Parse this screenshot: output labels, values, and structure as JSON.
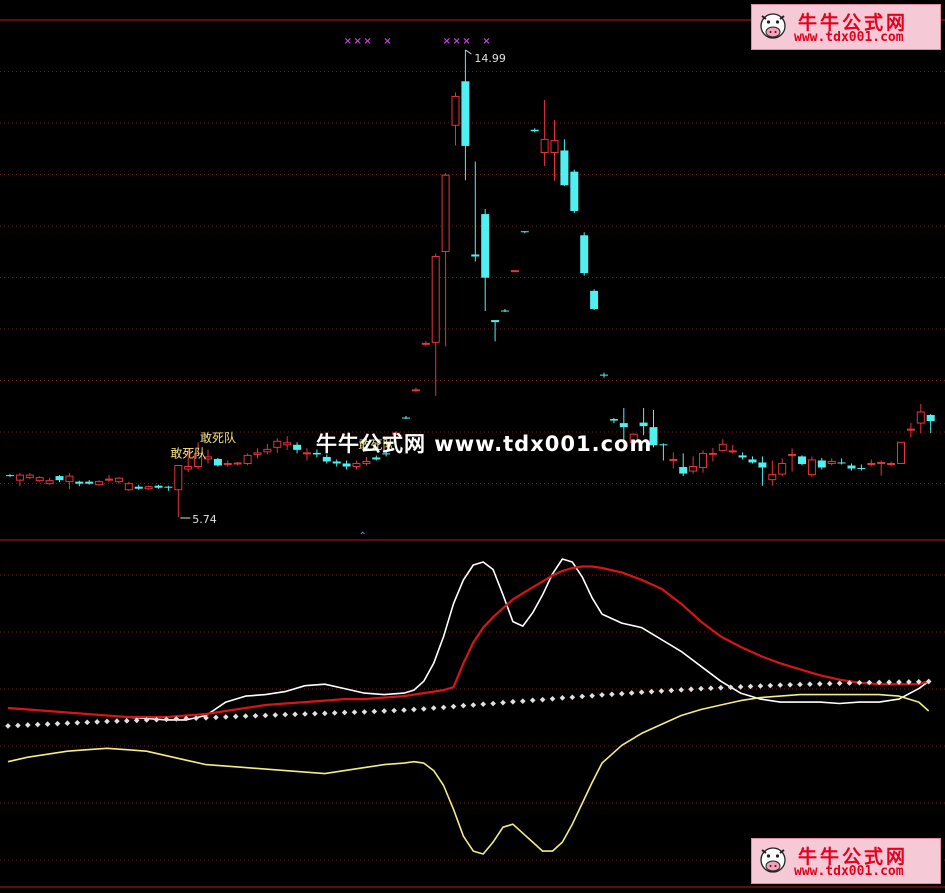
{
  "watermark": {
    "center_text": "牛牛公式网 www.tdx001.com",
    "logo_title": "牛牛公式网",
    "logo_url": "www.tdx001.com"
  },
  "colors": {
    "background": "#000000",
    "up_candle": "#e8333a",
    "down_candle": "#50f0f0",
    "grid": "#7a1616",
    "divider": "#c21818",
    "line_white": "#ffffff",
    "line_red": "#d81414",
    "line_yellow": "#f2ec82",
    "dots": "#e0e0e0",
    "markers": "#c040e0",
    "label": "#f0e080"
  },
  "chart_data": [
    {
      "type": "candlestick",
      "ylim": [
        5.4,
        15.6
      ],
      "annotations": {
        "high_label": "14.99",
        "low_label": "5.74",
        "signal_label": "敢死队"
      },
      "signal_label_candles": [
        17,
        20,
        36
      ],
      "top_marker_glyph": "×",
      "top_marker_candles": [
        34,
        35,
        36,
        38,
        44,
        45,
        46,
        48
      ],
      "bottom_marker_glyph": "⌃",
      "bottom_marker_candle": 35,
      "candles": [
        [
          6.57,
          6.55,
          6.59,
          6.53
        ],
        [
          6.47,
          6.57,
          6.61,
          6.35
        ],
        [
          6.52,
          6.57,
          6.61,
          6.49
        ],
        [
          6.46,
          6.52,
          6.55,
          6.44
        ],
        [
          6.4,
          6.46,
          6.52,
          6.38
        ],
        [
          6.55,
          6.47,
          6.57,
          6.43
        ],
        [
          6.44,
          6.55,
          6.61,
          6.29
        ],
        [
          6.44,
          6.4,
          6.46,
          6.35
        ],
        [
          6.44,
          6.4,
          6.47,
          6.38
        ],
        [
          6.38,
          6.44,
          6.47,
          6.36
        ],
        [
          6.48,
          6.49,
          6.57,
          6.43
        ],
        [
          6.44,
          6.51,
          6.53,
          6.4
        ],
        [
          6.28,
          6.4,
          6.44,
          6.26
        ],
        [
          6.34,
          6.3,
          6.38,
          6.28
        ],
        [
          6.3,
          6.34,
          6.36,
          6.28
        ],
        [
          6.36,
          6.32,
          6.38,
          6.3
        ],
        [
          6.34,
          6.32,
          6.36,
          6.26
        ],
        [
          6.28,
          6.76,
          6.76,
          5.74
        ],
        [
          6.69,
          6.74,
          7.1,
          6.63
        ],
        [
          6.74,
          7.0,
          7.22,
          6.69
        ],
        [
          6.89,
          6.93,
          7.07,
          6.8
        ],
        [
          6.89,
          6.76,
          6.91,
          6.74
        ],
        [
          6.8,
          6.8,
          6.86,
          6.74
        ],
        [
          6.79,
          6.81,
          6.83,
          6.76
        ],
        [
          6.8,
          6.96,
          7.0,
          6.76
        ],
        [
          6.98,
          7.01,
          7.1,
          6.9
        ],
        [
          7.03,
          7.08,
          7.19,
          6.98
        ],
        [
          7.12,
          7.24,
          7.3,
          7.01
        ],
        [
          7.17,
          7.21,
          7.34,
          7.07
        ],
        [
          7.17,
          7.07,
          7.22,
          7.0
        ],
        [
          7.0,
          7.01,
          7.1,
          6.86
        ],
        [
          7.01,
          6.98,
          7.08,
          6.92
        ],
        [
          6.93,
          6.84,
          6.98,
          6.8
        ],
        [
          6.84,
          6.8,
          6.88,
          6.74
        ],
        [
          6.8,
          6.74,
          6.86,
          6.68
        ],
        [
          6.74,
          6.8,
          6.86,
          6.68
        ],
        [
          6.8,
          6.84,
          6.93,
          6.76
        ],
        [
          6.92,
          6.88,
          6.96,
          6.86
        ],
        [
          7.0,
          6.98,
          7.05,
          6.94
        ],
        [
          7.4,
          7.4,
          7.44,
          7.36
        ],
        [
          7.71,
          7.7,
          7.74,
          7.68
        ],
        [
          8.26,
          8.26,
          8.3,
          8.22
        ],
        [
          9.18,
          9.18,
          9.22,
          9.12
        ],
        [
          9.2,
          10.9,
          10.96,
          8.14
        ],
        [
          11.0,
          12.51,
          12.55,
          9.12
        ],
        [
          13.5,
          14.07,
          14.15,
          13.1
        ],
        [
          14.37,
          13.09,
          14.99,
          12.41
        ],
        [
          10.94,
          10.9,
          12.78,
          10.8
        ],
        [
          11.74,
          10.48,
          11.84,
          9.82
        ],
        [
          9.64,
          9.6,
          9.6,
          9.22
        ],
        [
          9.83,
          9.82,
          9.86,
          9.8
        ],
        [
          10.62,
          10.62,
          10.62,
          10.6
        ],
        [
          11.4,
          11.38,
          11.4,
          11.36
        ],
        [
          13.41,
          13.38,
          13.44,
          13.36
        ],
        [
          12.96,
          13.22,
          14.0,
          12.69
        ],
        [
          12.96,
          13.2,
          13.6,
          12.4
        ],
        [
          13.0,
          12.31,
          13.22,
          12.3
        ],
        [
          12.58,
          11.8,
          12.62,
          11.76
        ],
        [
          11.32,
          10.57,
          11.38,
          10.52
        ],
        [
          10.22,
          9.86,
          10.25,
          9.84
        ],
        [
          8.56,
          8.55,
          8.6,
          8.5
        ],
        [
          7.68,
          7.65,
          7.7,
          7.6
        ],
        [
          7.6,
          7.52,
          7.9,
          7.22
        ],
        [
          7.22,
          7.38,
          7.4,
          7.2
        ],
        [
          7.61,
          7.54,
          7.9,
          7.36
        ],
        [
          7.52,
          7.16,
          7.86,
          7.12
        ],
        [
          7.18,
          7.16,
          7.2,
          6.86
        ],
        [
          6.88,
          6.88,
          7.02,
          6.7
        ],
        [
          6.73,
          6.6,
          7.0,
          6.55
        ],
        [
          6.65,
          6.74,
          6.94,
          6.6
        ],
        [
          6.72,
          7.0,
          7.06,
          6.62
        ],
        [
          7.0,
          7.0,
          7.11,
          6.84
        ],
        [
          7.06,
          7.18,
          7.28,
          7.04
        ],
        [
          7.04,
          7.05,
          7.17,
          7.0
        ],
        [
          6.96,
          6.92,
          7.02,
          6.88
        ],
        [
          6.88,
          6.82,
          6.94,
          6.8
        ],
        [
          6.82,
          6.72,
          6.94,
          6.36
        ],
        [
          6.48,
          6.58,
          6.86,
          6.36
        ],
        [
          6.59,
          6.8,
          6.9,
          6.55
        ],
        [
          6.98,
          6.98,
          7.1,
          6.64
        ],
        [
          6.94,
          6.79,
          6.96,
          6.76
        ],
        [
          6.58,
          6.87,
          6.94,
          6.53
        ],
        [
          6.86,
          6.72,
          6.91,
          6.68
        ],
        [
          6.8,
          6.84,
          6.9,
          6.76
        ],
        [
          6.82,
          6.8,
          6.9,
          6.78
        ],
        [
          6.76,
          6.7,
          6.8,
          6.66
        ],
        [
          6.71,
          6.7,
          6.78,
          6.66
        ],
        [
          6.8,
          6.8,
          6.88,
          6.74
        ],
        [
          6.8,
          6.82,
          6.86,
          6.56
        ],
        [
          6.8,
          6.8,
          6.84,
          6.74
        ],
        [
          6.8,
          7.22,
          7.22,
          6.8
        ],
        [
          7.46,
          7.48,
          7.6,
          7.32
        ],
        [
          7.6,
          7.82,
          7.98,
          7.4
        ],
        [
          7.76,
          7.64,
          7.78,
          7.4
        ]
      ]
    },
    {
      "type": "line",
      "ylim": [
        0,
        100
      ],
      "x": [
        0,
        2,
        4,
        6,
        8,
        10,
        12,
        14,
        16,
        18,
        20,
        22,
        24,
        26,
        28,
        30,
        32,
        34,
        36,
        38,
        40,
        41,
        42,
        43,
        44,
        45,
        46,
        47,
        48,
        49,
        50,
        51,
        52,
        53,
        54,
        55,
        56,
        57,
        58,
        59,
        60,
        62,
        64,
        66,
        68,
        70,
        72,
        74,
        76,
        78,
        80,
        82,
        84,
        86,
        88,
        90,
        92,
        93
      ],
      "series": [
        {
          "color": "white",
          "values": [
            51.0,
            50.5,
            50.0,
            49.5,
            49.0,
            48.5,
            48.0,
            47.5,
            47.0,
            47.0,
            48.5,
            53.0,
            55.0,
            55.5,
            56.5,
            58.5,
            59.0,
            57.5,
            56.0,
            55.5,
            56.0,
            57.0,
            60.0,
            66.0,
            75.0,
            86.0,
            94.0,
            99.0,
            100.0,
            97.5,
            89.0,
            80.0,
            78.5,
            83.0,
            89.0,
            96.0,
            101.0,
            100.0,
            95.0,
            88.0,
            82.5,
            79.5,
            78.0,
            74.0,
            70.0,
            65.0,
            60.0,
            56.0,
            54.0,
            53.0,
            53.0,
            53.0,
            52.5,
            53.0,
            53.0,
            54.0,
            57.5,
            60.0
          ]
        },
        {
          "color": "red",
          "values": [
            51.0,
            50.5,
            50.0,
            49.5,
            49.0,
            48.5,
            48.0,
            48.0,
            48.0,
            48.5,
            49.0,
            50.0,
            51.0,
            52.0,
            52.5,
            53.0,
            53.5,
            54.0,
            54.0,
            54.5,
            55.0,
            55.5,
            56.0,
            56.5,
            57.0,
            58.0,
            66.0,
            73.0,
            78.0,
            81.5,
            84.5,
            87.5,
            89.5,
            91.5,
            93.5,
            95.5,
            97.0,
            98.0,
            98.5,
            98.5,
            98.0,
            96.5,
            94.0,
            91.0,
            86.0,
            80.0,
            75.0,
            71.5,
            68.5,
            66.0,
            64.0,
            62.0,
            60.5,
            59.5,
            59.0,
            59.0,
            59.0,
            60.0
          ]
        },
        {
          "color": "yellow",
          "values": [
            33.0,
            34.5,
            35.5,
            36.5,
            37.0,
            37.5,
            37.0,
            36.5,
            35.0,
            33.5,
            32.0,
            31.5,
            31.0,
            30.5,
            30.0,
            29.5,
            29.0,
            30.0,
            31.0,
            32.0,
            32.5,
            33.0,
            32.5,
            30.0,
            25.0,
            17.0,
            8.0,
            3.0,
            2.0,
            6.0,
            11.0,
            12.0,
            9.0,
            6.0,
            3.0,
            3.0,
            6.0,
            12.0,
            19.0,
            26.0,
            32.5,
            38.5,
            42.5,
            45.5,
            48.5,
            50.5,
            52.0,
            53.5,
            54.5,
            55.0,
            55.5,
            55.5,
            55.5,
            55.5,
            55.5,
            55.0,
            53.0,
            50.0
          ]
        },
        {
          "color": "dotted-white",
          "values": [
            45.0,
            45.3,
            45.6,
            45.9,
            46.2,
            46.5,
            46.7,
            47.0,
            47.2,
            47.5,
            47.7,
            48.0,
            48.3,
            48.5,
            48.8,
            49.0,
            49.2,
            49.5,
            49.7,
            50.0,
            50.3,
            50.5,
            50.7,
            51.0,
            51.2,
            51.5,
            51.8,
            52.0,
            52.3,
            52.5,
            52.8,
            53.1,
            53.3,
            53.6,
            53.8,
            54.1,
            54.4,
            54.6,
            54.9,
            55.1,
            55.4,
            55.8,
            56.3,
            56.7,
            57.1,
            57.5,
            57.8,
            58.1,
            58.4,
            58.7,
            58.9,
            59.1,
            59.3,
            59.5,
            59.6,
            59.7,
            59.8,
            59.9
          ]
        }
      ]
    }
  ]
}
